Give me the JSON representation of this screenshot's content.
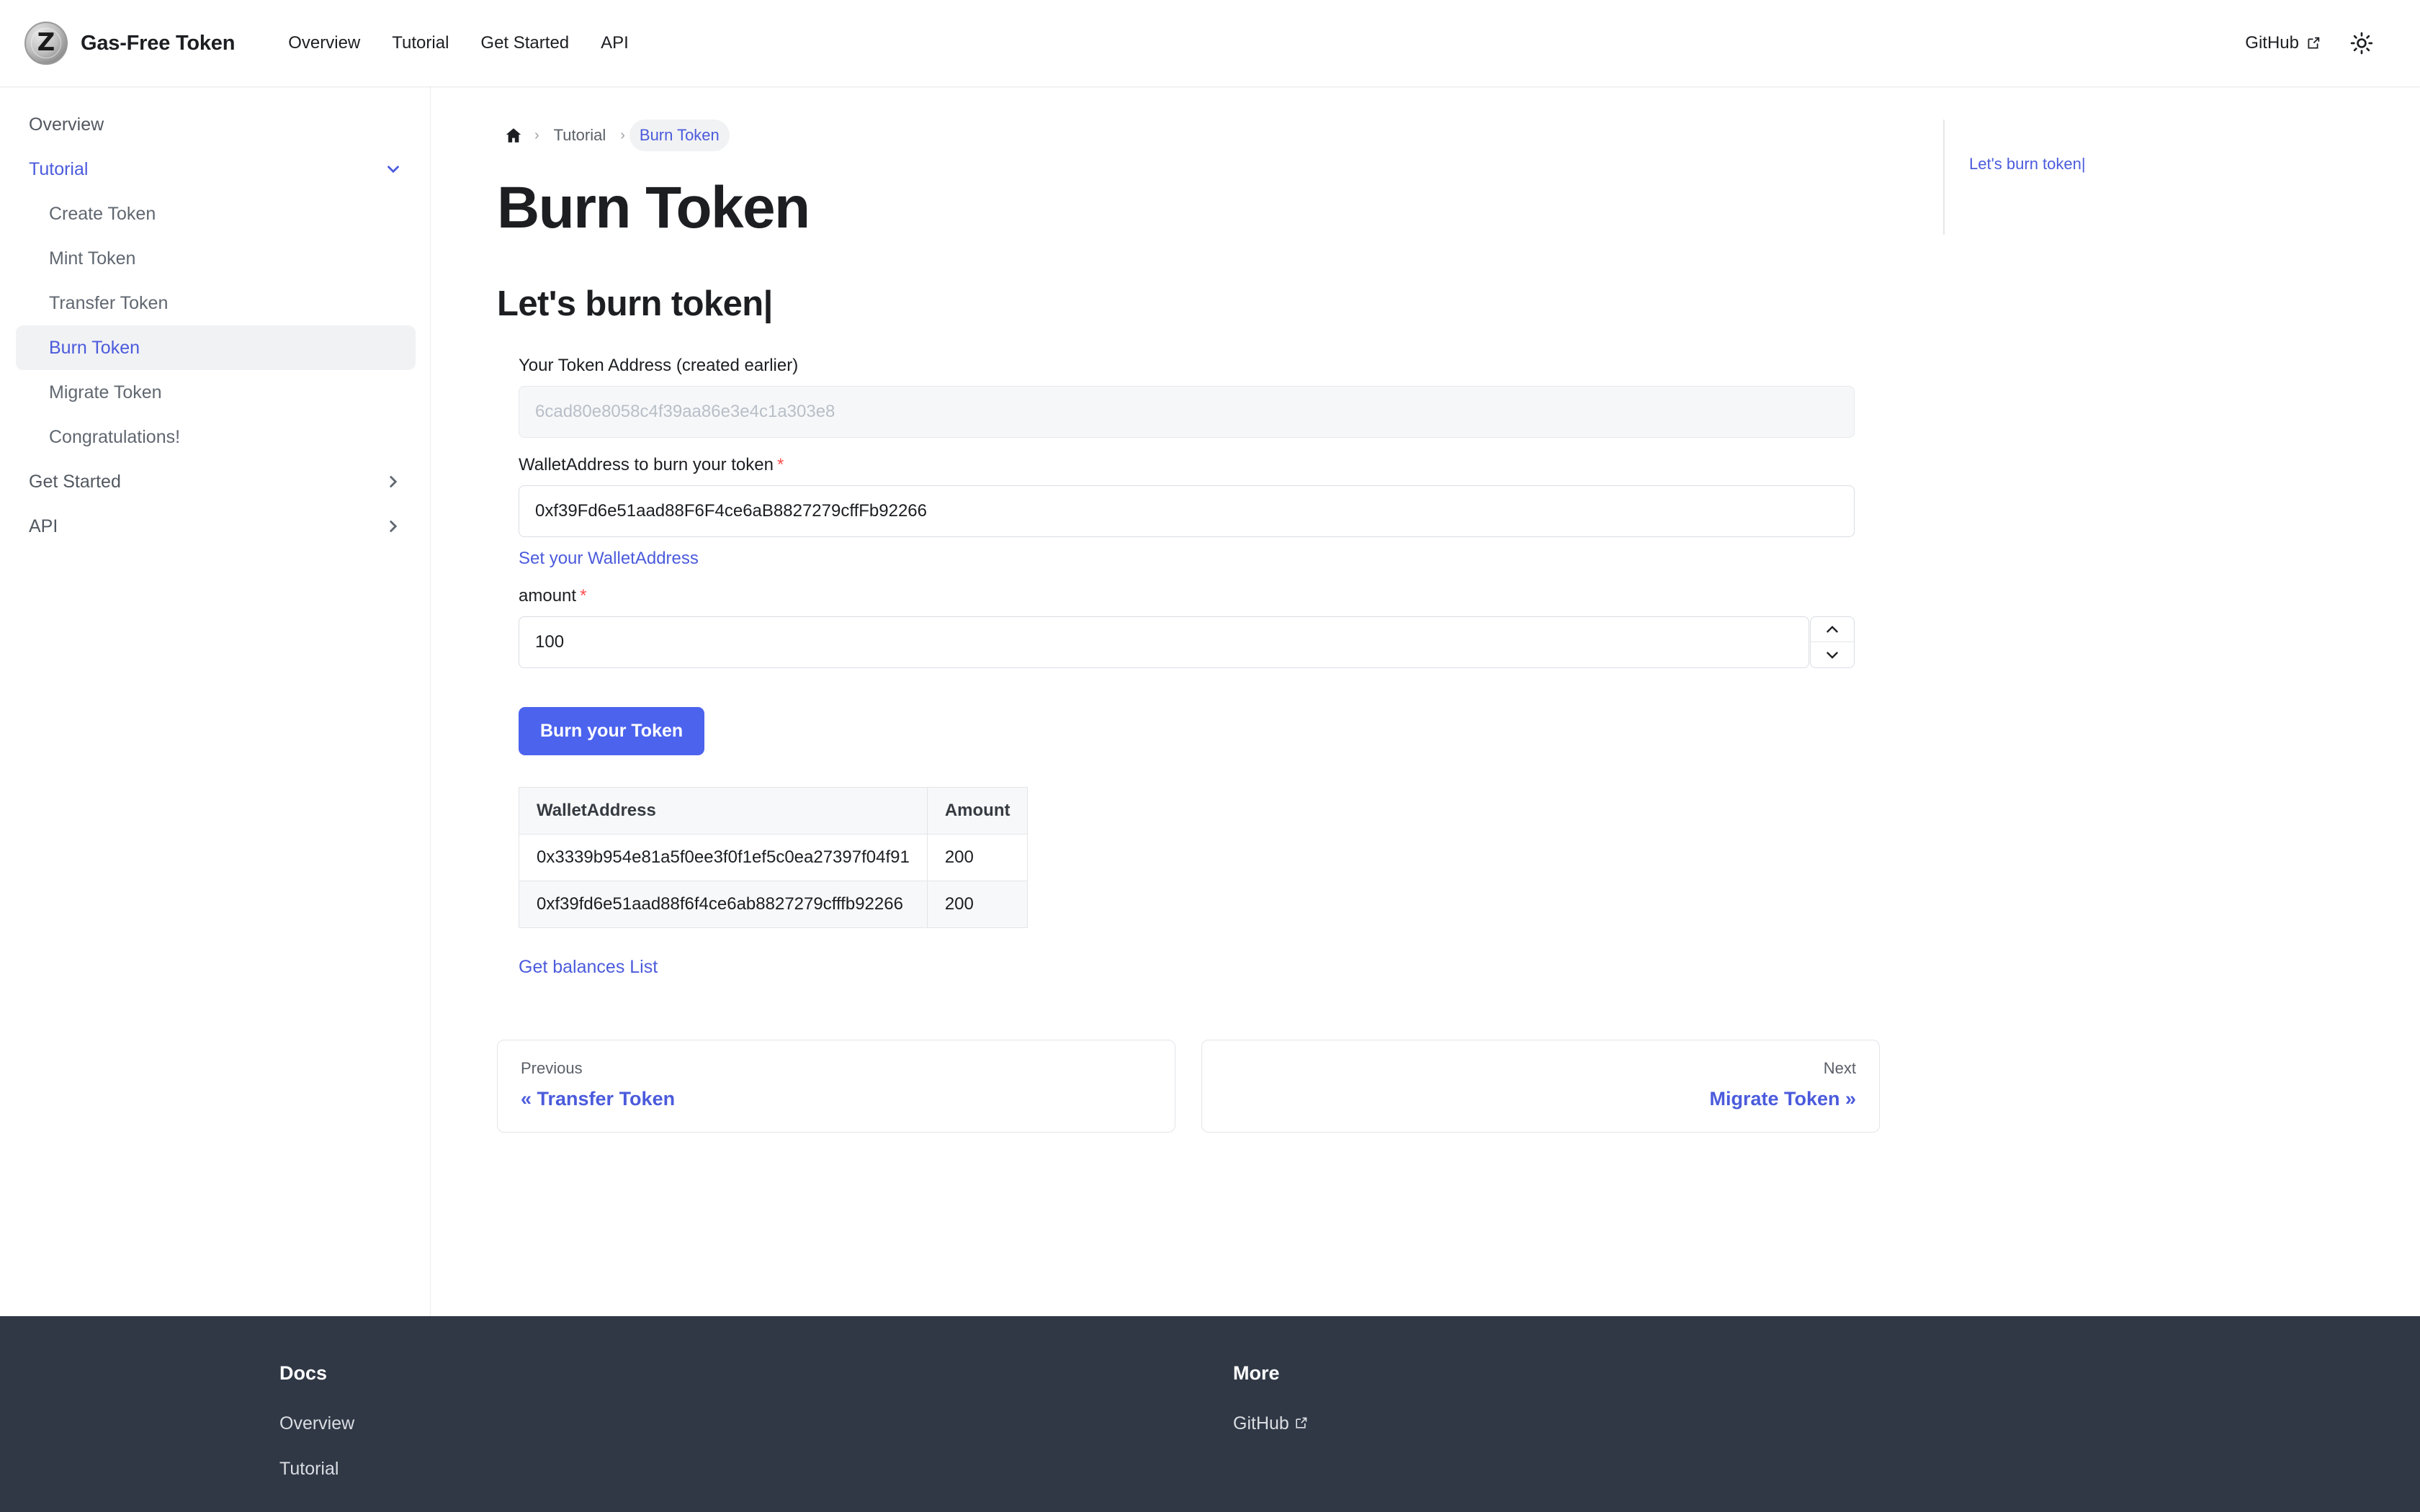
{
  "navbar": {
    "brand": "Gas-Free Token",
    "logo_glyph": "Z",
    "links": [
      "Overview",
      "Tutorial",
      "Get Started",
      "API"
    ],
    "github_label": "GitHub",
    "theme_icon": "sun-icon"
  },
  "sidebar": {
    "items": [
      {
        "label": "Overview",
        "level": "top",
        "state": "normal",
        "caret": ""
      },
      {
        "label": "Tutorial",
        "level": "top",
        "state": "active-parent",
        "caret": "down"
      },
      {
        "label": "Create Token",
        "level": "child",
        "state": "normal",
        "caret": ""
      },
      {
        "label": "Mint Token",
        "level": "child",
        "state": "normal",
        "caret": ""
      },
      {
        "label": "Transfer Token",
        "level": "child",
        "state": "normal",
        "caret": ""
      },
      {
        "label": "Burn Token",
        "level": "child",
        "state": "active",
        "caret": ""
      },
      {
        "label": "Migrate Token",
        "level": "child",
        "state": "normal",
        "caret": ""
      },
      {
        "label": "Congratulations!",
        "level": "child",
        "state": "normal",
        "caret": ""
      },
      {
        "label": "Get Started",
        "level": "top",
        "state": "normal",
        "caret": "right"
      },
      {
        "label": "API",
        "level": "top",
        "state": "normal",
        "caret": "right"
      }
    ]
  },
  "breadcrumb": {
    "home_icon": "home-icon",
    "items": [
      "Tutorial",
      "Burn Token"
    ]
  },
  "main": {
    "page_title": "Burn Token",
    "section_title": "Let's burn token|",
    "form": {
      "token_address_label": "Your Token Address (created earlier)",
      "token_address_placeholder": "6cad80e8058c4f39aa86e3e4c1a303e8",
      "token_address_value": "",
      "wallet_label": "WalletAddress to burn your token",
      "wallet_required_mark": "*",
      "wallet_value": "0xf39Fd6e51aad88F6F4ce6aB8827279cffFb92266",
      "wallet_placeholder": "",
      "set_wallet_link": "Set your WalletAddress",
      "amount_label": "amount",
      "amount_required_mark": "*",
      "amount_value": "100",
      "spin_up_icon": "chevron-up-icon",
      "spin_down_icon": "chevron-down-icon",
      "submit_label": "Burn your Token"
    },
    "table": {
      "headers": [
        "WalletAddress",
        "Amount"
      ],
      "rows": [
        [
          "0x3339b954e81a5f0ee3f0f1ef5c0ea27397f04f91",
          "200"
        ],
        [
          "0xf39fd6e51aad88f6f4ce6ab8827279cfffb92266",
          "200"
        ]
      ]
    },
    "balances_link": "Get balances List"
  },
  "pager": {
    "previous_kicker": "Previous",
    "previous_title": "« Transfer Token",
    "next_kicker": "Next",
    "next_title": "Migrate Token »"
  },
  "toc": {
    "items": [
      "Let's burn token|"
    ]
  },
  "footer": {
    "columns": [
      {
        "heading": "Docs",
        "links": [
          {
            "label": "Overview",
            "external": false
          },
          {
            "label": "Tutorial",
            "external": false
          }
        ]
      },
      {
        "heading": "More",
        "links": [
          {
            "label": "GitHub",
            "external": true
          }
        ]
      }
    ]
  },
  "colors": {
    "accent": "#4b5bdc",
    "button": "#4c63ee",
    "required": "#ff4d4f",
    "footer_bg": "#303846",
    "active_bg": "#f1f2f4"
  }
}
